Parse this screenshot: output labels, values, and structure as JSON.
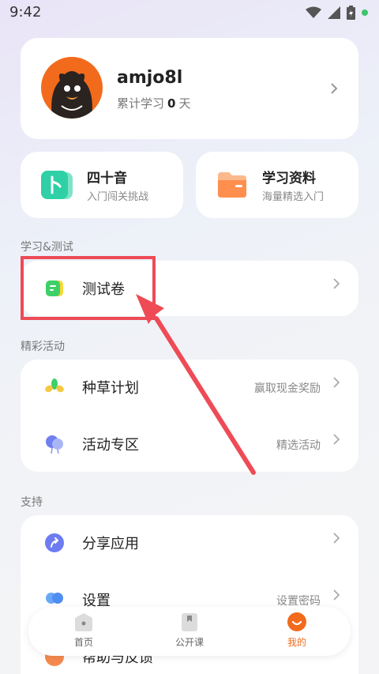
{
  "status_bar": {
    "time": "9:42"
  },
  "profile": {
    "username": "amjo8l",
    "study_prefix": "累计学习",
    "study_days": "0",
    "study_unit": "天"
  },
  "features": [
    {
      "title": "四十音",
      "subtitle": "入门闯关挑战"
    },
    {
      "title": "学习资料",
      "subtitle": "海量精选入门"
    }
  ],
  "sections": {
    "study": {
      "label": "学习&测试",
      "items": [
        {
          "label": "测试卷"
        }
      ]
    },
    "activities": {
      "label": "精彩活动",
      "items": [
        {
          "label": "种草计划",
          "right": "赢取现金奖励"
        },
        {
          "label": "活动专区",
          "right": "精选活动"
        }
      ]
    },
    "support": {
      "label": "支持",
      "items": [
        {
          "label": "分享应用"
        },
        {
          "label": "设置",
          "right": "设置密码"
        },
        {
          "label": "帮助与反馈"
        }
      ]
    }
  },
  "bottom_nav": [
    {
      "label": "首页",
      "icon": "home-icon"
    },
    {
      "label": "公开课",
      "icon": "bookmark-icon"
    },
    {
      "label": "我的",
      "icon": "profile-icon",
      "active": true
    }
  ],
  "colors": {
    "accent": "#f26a1c",
    "highlight": "#ee4b56"
  }
}
